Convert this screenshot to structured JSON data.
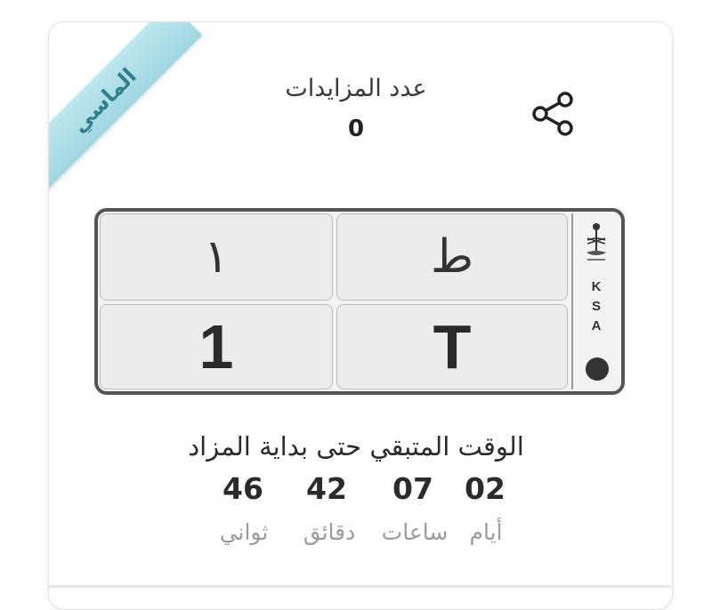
{
  "badge": {
    "label": "الماسي",
    "color": "#a9dde6"
  },
  "bids": {
    "label": "عدد المزايدات",
    "count": "0"
  },
  "share": {
    "icon": "share-icon"
  },
  "plate": {
    "arabic_letter": "ط",
    "arabic_number": "١",
    "latin_letter": "T",
    "latin_number": "1",
    "country_code": [
      "K",
      "S",
      "A"
    ]
  },
  "countdown": {
    "title": "الوقت المتبقي حتى بداية المزاد",
    "units": [
      {
        "value": "02",
        "label": "أيام"
      },
      {
        "value": "07",
        "label": "ساعات"
      },
      {
        "value": "42",
        "label": "دقائق"
      },
      {
        "value": "46",
        "label": "ثواني"
      }
    ]
  }
}
